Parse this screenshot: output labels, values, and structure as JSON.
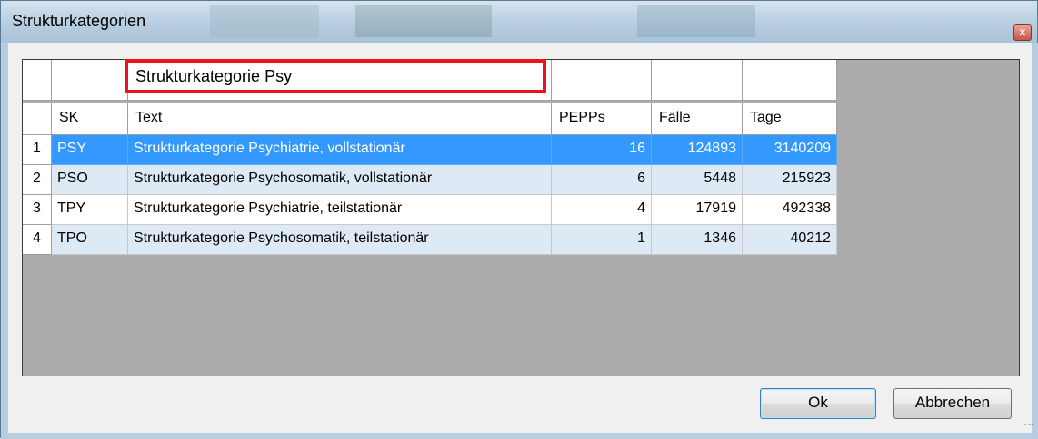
{
  "window": {
    "title": "Strukturkategorien",
    "close_label": "x"
  },
  "filter": {
    "value": "Strukturkategorie Psy"
  },
  "table": {
    "columns": [
      "SK",
      "Text",
      "PEPPs",
      "Fälle",
      "Tage"
    ],
    "rows": [
      {
        "num": "1",
        "sk": "PSY",
        "text": "Strukturkategorie Psychiatrie, vollstationär",
        "pepps": "16",
        "faelle": "124893",
        "tage": "3140209"
      },
      {
        "num": "2",
        "sk": "PSO",
        "text": "Strukturkategorie Psychosomatik, vollstationär",
        "pepps": "6",
        "faelle": "5448",
        "tage": "215923"
      },
      {
        "num": "3",
        "sk": "TPY",
        "text": "Strukturkategorie Psychiatrie, teilstationär",
        "pepps": "4",
        "faelle": "17919",
        "tage": "492338"
      },
      {
        "num": "4",
        "sk": "TPO",
        "text": "Strukturkategorie Psychosomatik, teilstationär",
        "pepps": "1",
        "faelle": "1346",
        "tage": "40212"
      }
    ]
  },
  "buttons": {
    "ok": "Ok",
    "cancel": "Abbrechen"
  },
  "colors": {
    "selection": "#3399ff",
    "alt_row": "#dde9f5",
    "filter_highlight": "#e8151f",
    "grid_background": "#ababab"
  }
}
